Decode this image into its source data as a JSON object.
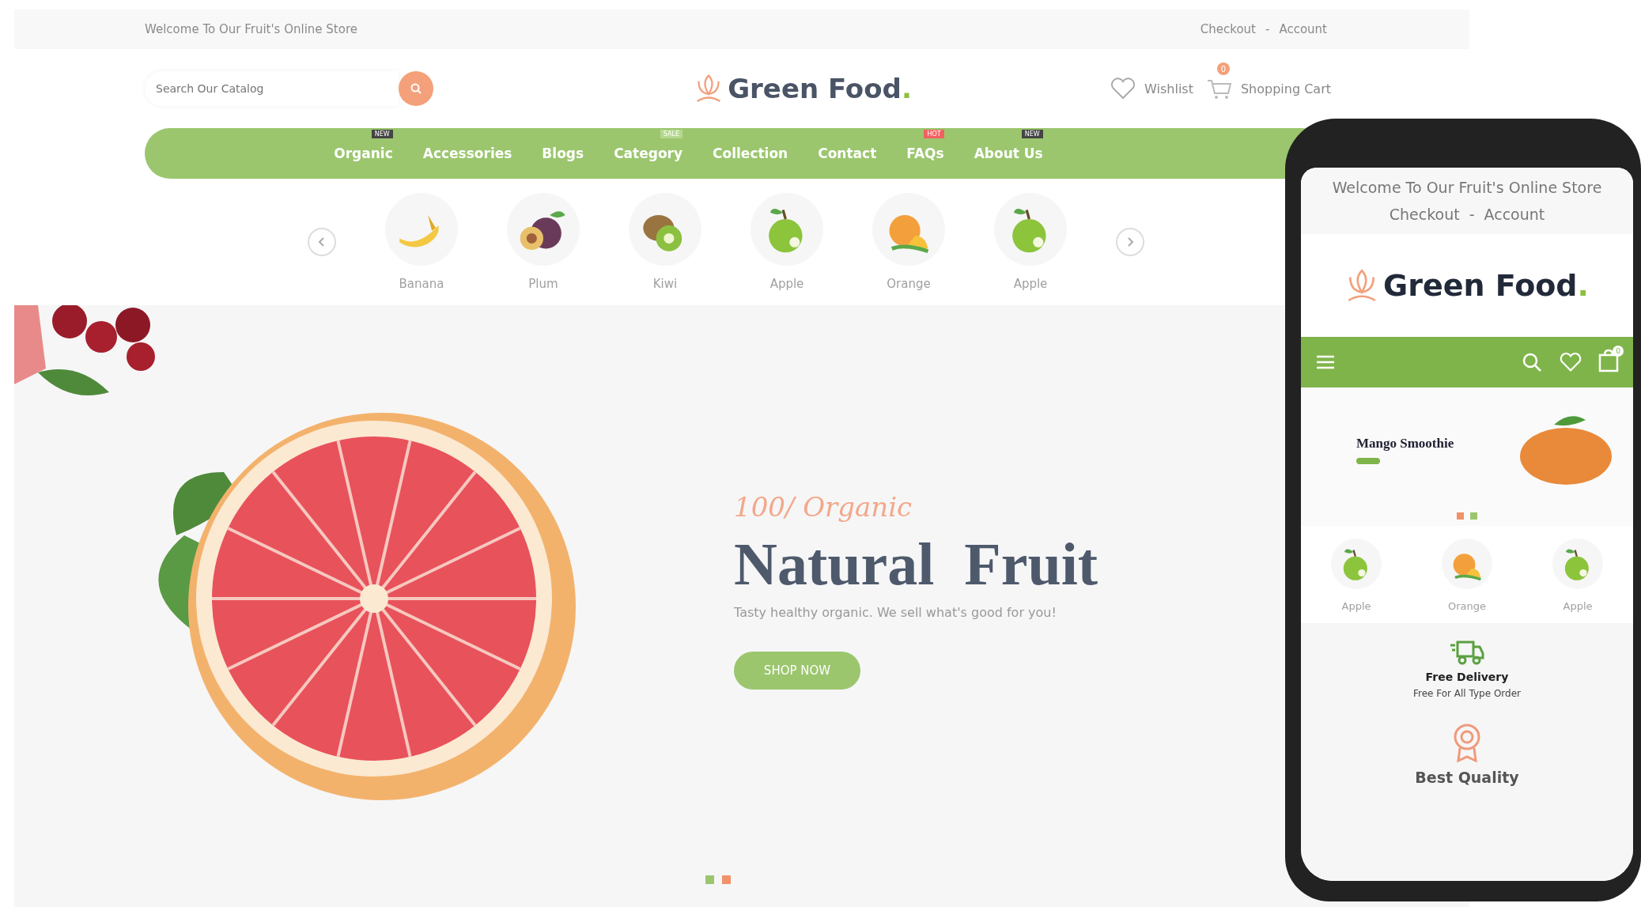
{
  "desktop": {
    "top_bar": {
      "welcome": "Welcome To Our Fruit's Online Store",
      "links": [
        "Checkout",
        "Account"
      ],
      "separator": "-"
    },
    "search": {
      "placeholder": "Search Our Catalog"
    },
    "logo": {
      "name": "Green Food",
      "dot": "."
    },
    "header_links": {
      "wishlist": "Wishlist",
      "cart": "Shopping Cart",
      "cart_count": "0"
    },
    "nav": [
      {
        "label": "Organic",
        "badge": {
          "text": "NEW",
          "color": "#444444"
        }
      },
      {
        "label": "Accessories"
      },
      {
        "label": "Blogs"
      },
      {
        "label": "Category",
        "badge": {
          "text": "SALE",
          "color": "#b6d88e"
        }
      },
      {
        "label": "Collection"
      },
      {
        "label": "Contact"
      },
      {
        "label": "FAQs",
        "badge": {
          "text": "HOT",
          "color": "#f26060"
        }
      },
      {
        "label": "About Us",
        "badge": {
          "text": "NEW",
          "color": "#444444"
        }
      }
    ],
    "categories": [
      {
        "label": "Banana",
        "kind": "banana"
      },
      {
        "label": "Plum",
        "kind": "plum"
      },
      {
        "label": "Kiwi",
        "kind": "kiwi"
      },
      {
        "label": "Apple",
        "kind": "apple"
      },
      {
        "label": "Orange",
        "kind": "citrus"
      },
      {
        "label": "Apple",
        "kind": "apple"
      }
    ],
    "hero": {
      "kicker": "100/ Organic",
      "title": "Natural  Fruit",
      "tagline": "Tasty healthy organic. We sell what's good for you!",
      "button": "SHOP NOW"
    },
    "slider_dots": [
      {
        "selected": false
      },
      {
        "selected": true
      }
    ]
  },
  "phone": {
    "top_bar": {
      "welcome": "Welcome To Our Fruit's Online Store",
      "links": [
        "Checkout",
        "Account"
      ],
      "separator": "-"
    },
    "logo": {
      "name": "Green Food",
      "dot": "."
    },
    "cart_count": "0",
    "slide": {
      "title": "Mango Smoothie"
    },
    "slider_dots": [
      {
        "selected": true
      },
      {
        "selected": false
      }
    ],
    "categories": [
      {
        "label": "Apple",
        "kind": "apple"
      },
      {
        "label": "Orange",
        "kind": "citrus"
      },
      {
        "label": "Apple",
        "kind": "apple"
      }
    ],
    "features": [
      {
        "title": "Free Delivery",
        "subtitle": "Free For All Type Order",
        "kind": "delivery"
      },
      {
        "title": "Best Quality",
        "kind": "quality"
      }
    ]
  }
}
